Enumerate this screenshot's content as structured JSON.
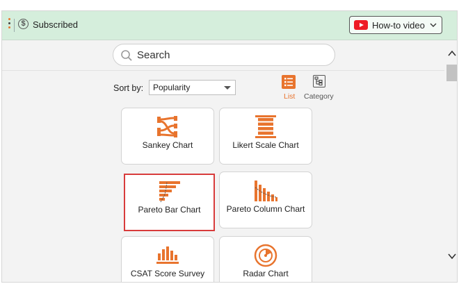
{
  "header": {
    "subscription": {
      "label": "Subscribed",
      "icon": "dollar-coin-icon"
    },
    "howto": {
      "label": "How-to video",
      "icon": "youtube-icon"
    }
  },
  "search": {
    "placeholder": "Search"
  },
  "sort": {
    "label": "Sort by:",
    "selected": "Popularity"
  },
  "views": [
    {
      "label": "List",
      "active": true,
      "icon": "list-icon"
    },
    {
      "label": "Category",
      "active": false,
      "icon": "category-tree-icon"
    }
  ],
  "cards": [
    {
      "label": "Sankey Chart",
      "icon": "sankey-chart-icon",
      "selected": false
    },
    {
      "label": "Likert Scale Chart",
      "icon": "likert-scale-chart-icon",
      "selected": false
    },
    {
      "label": "Pareto Bar Chart",
      "icon": "pareto-bar-chart-icon",
      "selected": true
    },
    {
      "label": "Pareto Column Chart",
      "icon": "pareto-column-chart-icon",
      "selected": false
    },
    {
      "label": "CSAT Score Survey",
      "icon": "csat-score-survey-icon",
      "selected": false
    },
    {
      "label": "Radar Chart",
      "icon": "radar-chart-icon",
      "selected": false
    }
  ],
  "colors": {
    "accent": "#e8742e",
    "header_bg": "#d5eedc",
    "selection_border": "#d83b3b"
  }
}
